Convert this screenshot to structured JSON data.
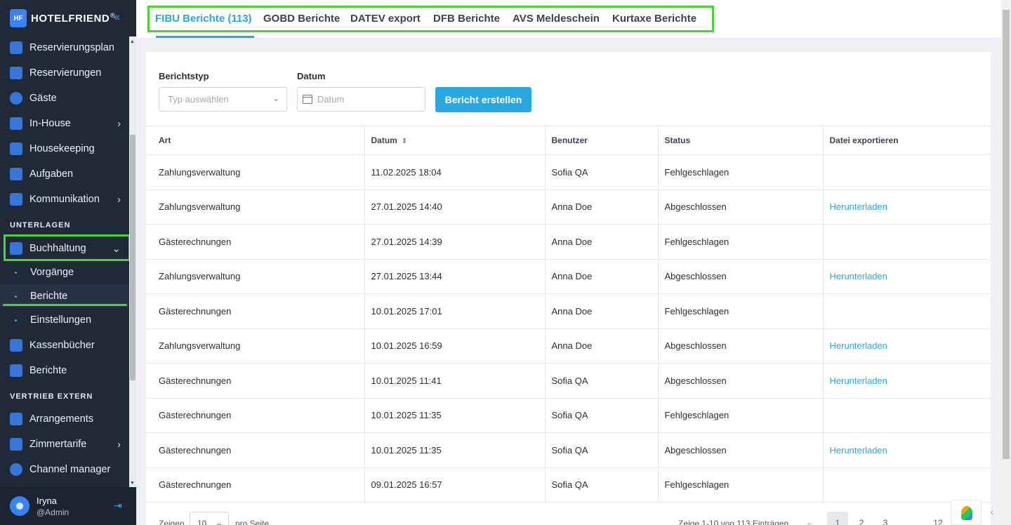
{
  "app": {
    "brand": "HOTELFRIEND",
    "brand_mark": "®"
  },
  "sidebar": {
    "items": [
      {
        "label": "Reservierungsplan"
      },
      {
        "label": "Reservierungen"
      },
      {
        "label": "Gäste"
      },
      {
        "label": "In-House"
      },
      {
        "label": "Housekeeping"
      },
      {
        "label": "Aufgaben"
      },
      {
        "label": "Kommunikation"
      }
    ],
    "section_unterlagen": "UNTERLAGEN",
    "buchhaltung": "Buchhaltung",
    "sub_items": [
      {
        "label": "Vorgänge"
      },
      {
        "label": "Berichte"
      },
      {
        "label": "Einstellungen"
      }
    ],
    "items2": [
      {
        "label": "Kassenbücher"
      },
      {
        "label": "Berichte"
      }
    ],
    "section_vertrieb": "VERTRIEB EXTERN",
    "items3": [
      {
        "label": "Arrangements"
      },
      {
        "label": "Zimmertarife"
      },
      {
        "label": "Channel manager"
      }
    ],
    "user": {
      "name": "Iryna",
      "role": "@Admin"
    }
  },
  "tabs": [
    {
      "label": "FIBU Berichte (113)"
    },
    {
      "label": "GOBD Berichte"
    },
    {
      "label": "DATEV export"
    },
    {
      "label": "DFB Berichte"
    },
    {
      "label": "AVS Meldeschein"
    },
    {
      "label": "Kurtaxe Berichte"
    }
  ],
  "filters": {
    "type_label": "Berichtstyp",
    "type_placeholder": "Typ auswählen",
    "date_label": "Datum",
    "date_placeholder": "Datum",
    "create_button": "Bericht erstellen"
  },
  "table": {
    "headers": [
      "Art",
      "Datum",
      "Benutzer",
      "Status",
      "Datei exportieren"
    ],
    "rows": [
      [
        "Zahlungsverwaltung",
        "11.02.2025 18:04",
        "Sofia QA",
        "Fehlgeschlagen",
        ""
      ],
      [
        "Zahlungsverwaltung",
        "27.01.2025 14:40",
        "Anna Doe",
        "Abgeschlossen",
        "Herunterladen"
      ],
      [
        "Gästerechnungen",
        "27.01.2025 14:39",
        "Anna Doe",
        "Fehlgeschlagen",
        ""
      ],
      [
        "Zahlungsverwaltung",
        "27.01.2025 13:44",
        "Anna Doe",
        "Abgeschlossen",
        "Herunterladen"
      ],
      [
        "Gästerechnungen",
        "10.01.2025 17:01",
        "Anna Doe",
        "Fehlgeschlagen",
        ""
      ],
      [
        "Zahlungsverwaltung",
        "10.01.2025 16:59",
        "Anna Doe",
        "Abgeschlossen",
        "Herunterladen"
      ],
      [
        "Gästerechnungen",
        "10.01.2025 11:41",
        "Sofia QA",
        "Abgeschlossen",
        "Herunterladen"
      ],
      [
        "Gästerechnungen",
        "10.01.2025 11:35",
        "Sofia QA",
        "Fehlgeschlagen",
        ""
      ],
      [
        "Gästerechnungen",
        "10.01.2025 11:35",
        "Sofia QA",
        "Abgeschlossen",
        "Herunterladen"
      ],
      [
        "Gästerechnungen",
        "09.01.2025 16:57",
        "Sofia QA",
        "Fehlgeschlagen",
        ""
      ]
    ]
  },
  "pager": {
    "show_label": "Zeigen",
    "per_page": "10",
    "per_page_label": "pro Seite",
    "info": "Zeige 1-10 von 113 Einträgen",
    "pages": [
      "1",
      "2",
      "3",
      "12"
    ]
  },
  "colors": {
    "accent": "#29a8e0",
    "highlight": "#4cd137",
    "sidebar_bg": "#1f2937"
  }
}
